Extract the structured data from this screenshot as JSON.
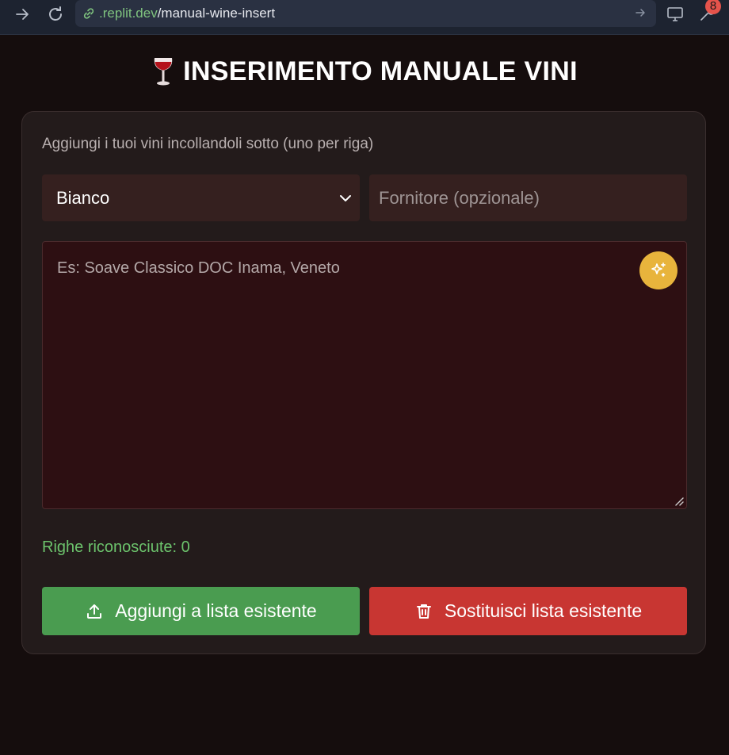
{
  "browser": {
    "url_domain": ".replit.dev",
    "url_path": "/manual-wine-insert",
    "notification_count": "8"
  },
  "page": {
    "title_emoji": "wine-glass-icon",
    "title": "INSERIMENTO MANUALE VINI"
  },
  "form": {
    "hint": "Aggiungi i tuoi vini incollandoli sotto (uno per riga)",
    "wine_type_selected": "Bianco",
    "supplier_placeholder": "Fornitore (opzionale)",
    "supplier_value": "",
    "wines_placeholder": "Es: Soave Classico DOC Inama, Veneto",
    "wines_value": "",
    "recognized_rows_label": "Righe riconosciute: 0"
  },
  "actions": {
    "add_label": "Aggiungi a lista esistente",
    "replace_label": "Sostituisci lista esistente"
  },
  "colors": {
    "page_bg": "#150d0d",
    "card_bg": "#231b1b",
    "add_button": "#4a9c50",
    "replace_button": "#c83632",
    "magic_button": "#e8b43c",
    "success_text": "#6cc36c"
  }
}
